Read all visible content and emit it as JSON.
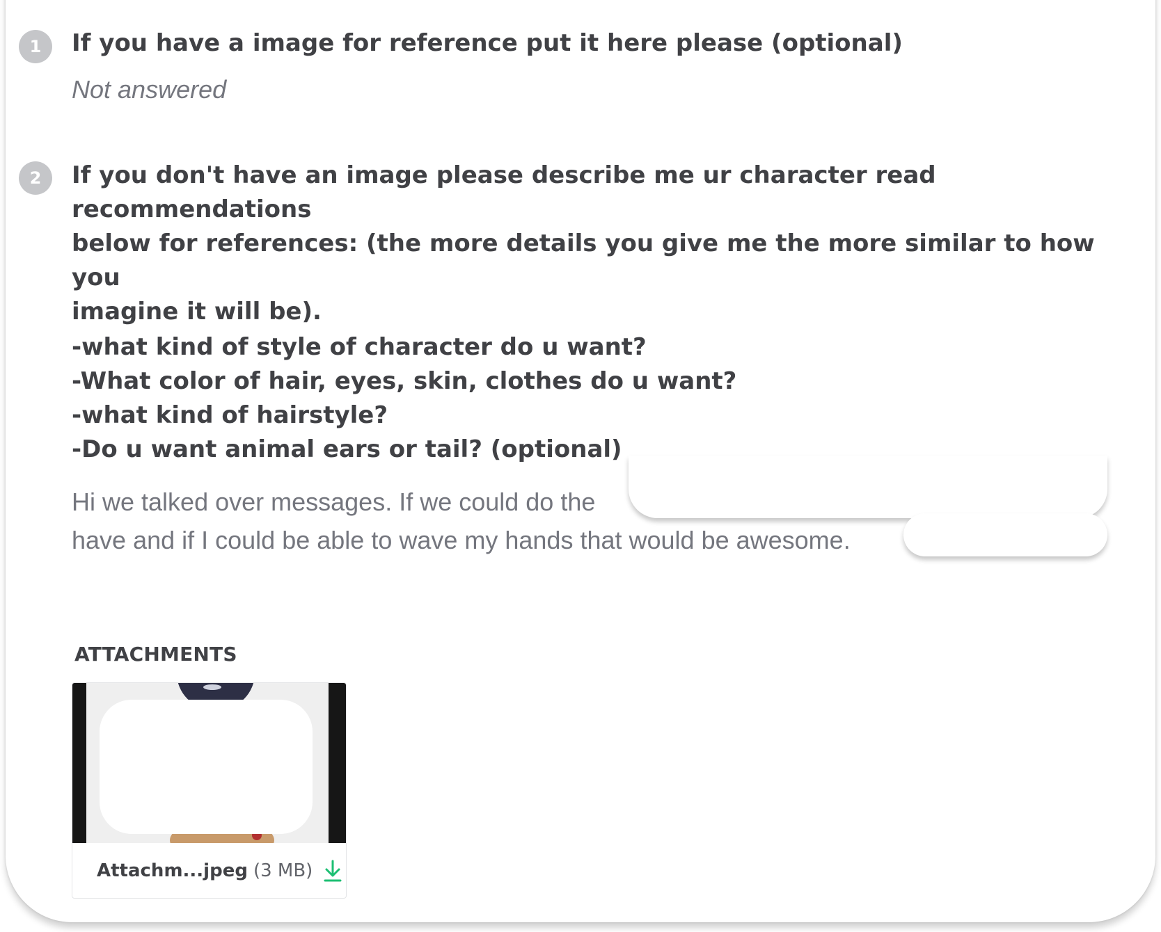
{
  "questions": [
    {
      "number": "1",
      "text": "If you have a image for reference put it here please (optional)",
      "answer": "Not answered"
    },
    {
      "number": "2",
      "text": "If you don't have an image please describe me ur character read recommendations\nbelow for references: (the more details you give me the more similar to how you\nimagine it will be).",
      "sub_text": "-what kind of style of character do u want?\n-What color of hair, eyes, skin, clothes do u want?\n-what kind of hairstyle?\n-Do u want animal ears or tail? (optional)",
      "answer_lines": [
        "Hi we talked over messages. If we could do the",
        "have and if I could be able to wave my hands that would be awesome."
      ]
    }
  ],
  "attachments": {
    "label": "ATTACHMENTS",
    "items": [
      {
        "name": "Attachm...jpeg",
        "size": "(3 MB)",
        "icon": "download-icon",
        "icon_color": "#1dbf73"
      }
    ]
  }
}
